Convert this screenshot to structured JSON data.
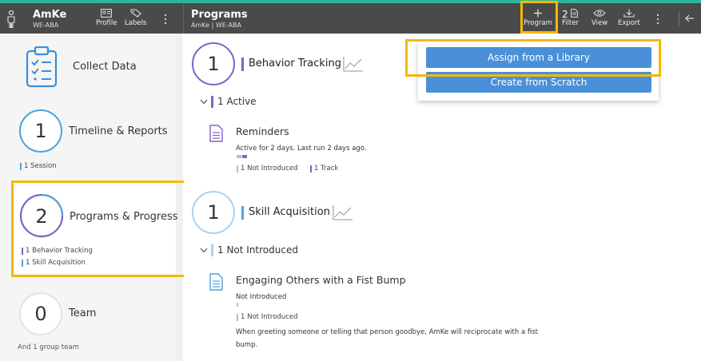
{
  "app": {
    "org_name": "AmKe",
    "org_sub": "WE-ABA",
    "profile_label": "Profile",
    "labels_label": "Labels"
  },
  "header": {
    "title": "Programs",
    "subtitle": "AmKe | WE-ABA",
    "program_label": "Program",
    "filter_count": "2",
    "filter_label": "Filter",
    "view_label": "View",
    "export_label": "Export"
  },
  "sidebar": {
    "collect": {
      "label": "Collect Data"
    },
    "timeline": {
      "count": "1",
      "label": "Timeline & Reports",
      "tag": "1 Session"
    },
    "programs": {
      "count": "2",
      "label": "Programs & Progress",
      "tags": [
        "1 Behavior Tracking",
        "1 Skill Acquisition"
      ]
    },
    "team": {
      "count": "0",
      "label": "Team",
      "tag": "And 1 group team"
    }
  },
  "main": {
    "behavior": {
      "count": "1",
      "title": "Behavior Tracking",
      "group": "1 Active",
      "item": {
        "title": "Reminders",
        "status": "Active for 2 days. Last run 2 days ago.",
        "tag1": "1 Not Introduced",
        "tag2": "1 Track"
      }
    },
    "skill": {
      "count": "1",
      "title": "Skill Acquisition",
      "group": "1 Not Introduced",
      "item": {
        "title": "Engaging Others with a Fist Bump",
        "status": "Not Introduced",
        "tag1": "1 Not Introduced",
        "description": "When greeting someone or telling that person goodbye, AmKe will reciprocate with a fist bump."
      }
    }
  },
  "popup": {
    "assign_label": "Assign from a Library",
    "create_label": "Create from Scratch"
  },
  "colors": {
    "accent_blue": "#4a90d9",
    "behavior_purple": "#7e63c9",
    "skill_blue": "#5aa3dd",
    "highlight": "#f5b800",
    "topbar": "#4a4a4a",
    "stripe": "#2bb59a"
  }
}
